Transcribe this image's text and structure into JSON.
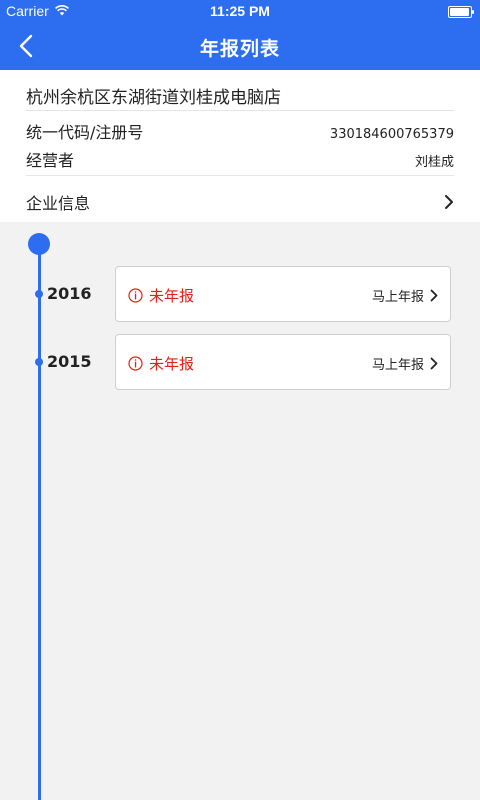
{
  "status_bar": {
    "carrier": "Carrier",
    "time": "11:25 PM",
    "battery_level": 0.95
  },
  "nav": {
    "title": "年报列表"
  },
  "company": {
    "name": "杭州余杭区东湖街道刘桂成电脑店",
    "code_label": "统一代码/注册号",
    "code_value": "330184600765379",
    "operator_label": "经营者",
    "operator_value": "刘桂成",
    "enterprise_info_label": "企业信息"
  },
  "reports": [
    {
      "year": "2016",
      "status": "未年报",
      "action": "马上年报"
    },
    {
      "year": "2015",
      "status": "未年报",
      "action": "马上年报"
    }
  ],
  "colors": {
    "primary": "#2d6ef0",
    "warning": "#e0221a"
  }
}
